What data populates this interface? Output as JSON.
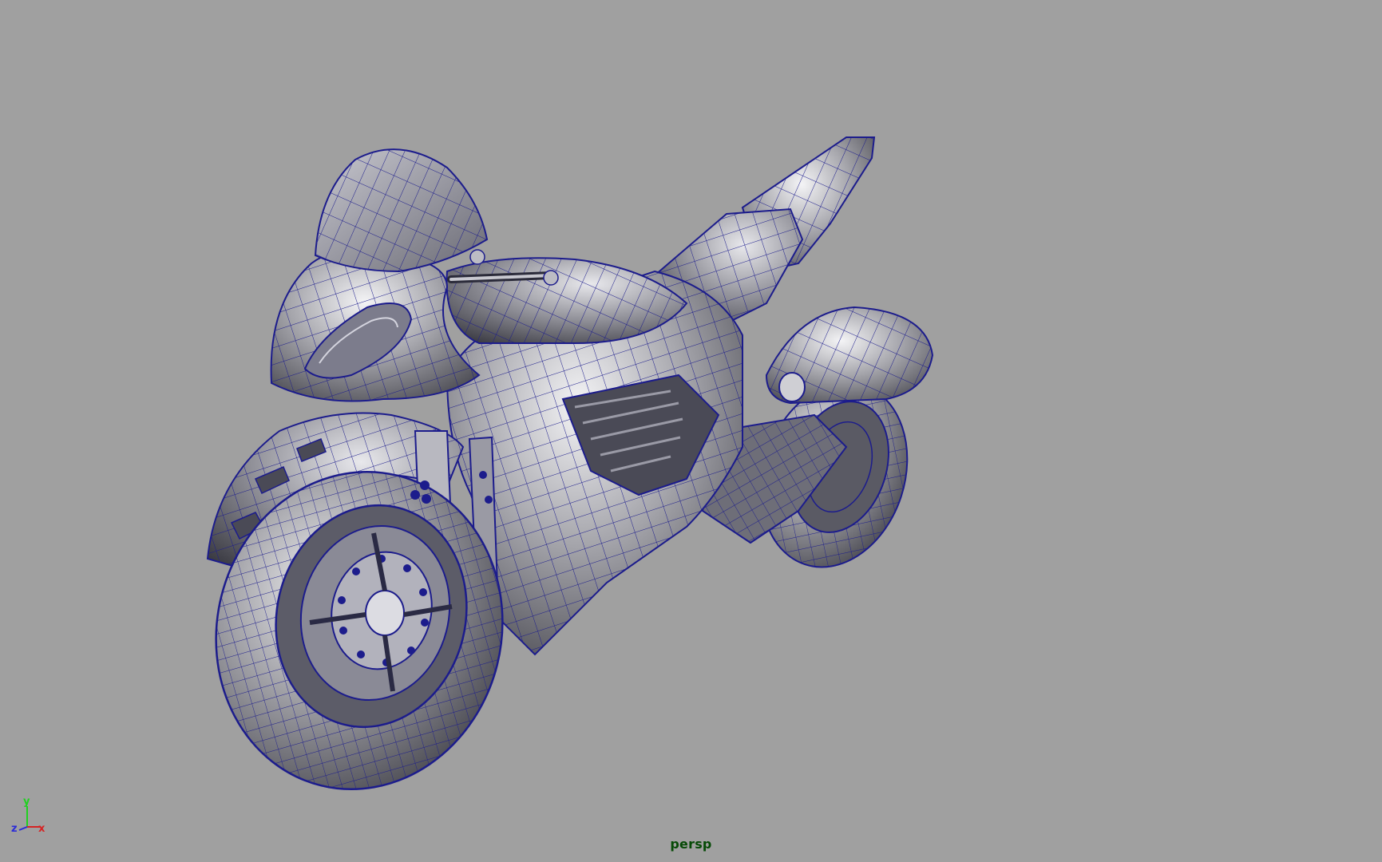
{
  "viewport": {
    "camera_label": "persp",
    "background_color": "#a0a0a0",
    "wire_color": "#1c1c8c",
    "shade_color": "#8e8e94"
  },
  "axis_gizmo": {
    "y_label": "y",
    "z_label": "z",
    "x_label": "x",
    "y_color": "#1fd11f",
    "z_color": "#2b2bd8",
    "x_color": "#d52424"
  },
  "model": {
    "icon": "motorcycle-wireframe-icon"
  }
}
